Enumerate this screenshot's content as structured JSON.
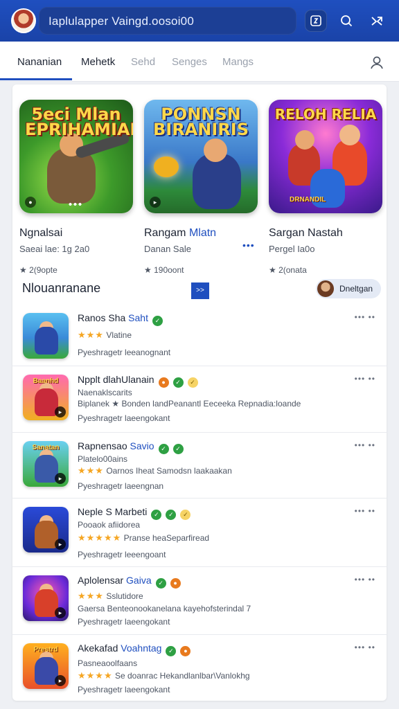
{
  "header": {
    "search_text": "Iaplulapper Vaingd.oosoi00",
    "colors": {
      "bar": "#1f4fbf",
      "accent": "#1f4fbf"
    },
    "icons": [
      "profile-avatar",
      "grid-icon",
      "search-icon",
      "share-icon"
    ]
  },
  "tabs": {
    "items": [
      {
        "label": "Nananian"
      },
      {
        "label": "Mehetk"
      },
      {
        "label": "Sehd"
      },
      {
        "label": "Senges"
      },
      {
        "label": "Mangs"
      }
    ],
    "active_index": 0,
    "profile_icon": "person-icon"
  },
  "featured": [
    {
      "art_title": "5eci Mlan\nEPRIHAMIAK",
      "name": "Ngnalsai",
      "name_accent": "",
      "meta": "Saeai lae: 1g 2a0",
      "count": "★ 2(9opte"
    },
    {
      "art_title": "PONNSN\nBIRANIRIS",
      "name": "Rangam",
      "name_accent": "Mlatn",
      "meta": "Danan Sale",
      "count": "★ 190oont",
      "more": "•••"
    },
    {
      "art_title": "RELOH RELIA",
      "art_subtitle": "DRNANDIL",
      "name": "Sargan Nastah",
      "name_accent": "",
      "meta": "Pergel Ia0o",
      "count": "★ 2(onata"
    }
  ],
  "section": {
    "title": "Nlouanranane",
    "chip": ">>",
    "pill_label": "Dneltgan"
  },
  "apps": [
    {
      "title": "Ranos Sha",
      "title_accent": "Saht",
      "badges": [
        "green"
      ],
      "line1_stars": "★★★",
      "line1": "Vlatine",
      "line2": "",
      "foot": "Pyeshragetr leeanognant"
    },
    {
      "title": "Npplt dlahUlanain",
      "title_accent": "",
      "badges": [
        "orange",
        "green",
        "yellow"
      ],
      "line1_stars": "",
      "line1": "Naenaklscarits",
      "line2": "Biplanek ★ Bonden landPeanantl Eeceeka Repnadia:loande",
      "foot": "Pyeshragetr laeengokant"
    },
    {
      "title": "Rapnensao",
      "title_accent": "Savio",
      "badges": [
        "green",
        "green"
      ],
      "line1_stars": "",
      "line1": "Platelo00ains",
      "line2_stars": "★★★",
      "line2": "Oarnos Iheat Samodsn laakaakan",
      "foot": "Pyeshragetr laeengnan"
    },
    {
      "title": "Neple S Marbeti",
      "title_accent": "",
      "badges": [
        "green",
        "green",
        "yellow"
      ],
      "line1_stars": "",
      "line1": "Pooaok afiidorea",
      "line2_stars": "★★★★★",
      "line2": "Pranse heaSeparfiread",
      "foot": "Pyeshragetr leeengoant"
    },
    {
      "title": "Aplolensar",
      "title_accent": "Gaiva",
      "badges": [
        "green",
        "orange"
      ],
      "line1_stars": "★★★",
      "line1": "Sslutidore",
      "line2": "Gaersa Benteonookanelana kayehofsterindal 7",
      "foot": "Pyeshragetr laeengokant"
    },
    {
      "title": "Akekafad",
      "title_accent": "Voahntag",
      "badges": [
        "green",
        "orange"
      ],
      "line1_stars": "",
      "line1": "Pasneaoolfaans",
      "line2_stars": "★★★★",
      "line2": "Se doanrac Hekandlanlbar\\Vanlokhg",
      "foot": "Pyeshragetr laeengokant"
    }
  ]
}
